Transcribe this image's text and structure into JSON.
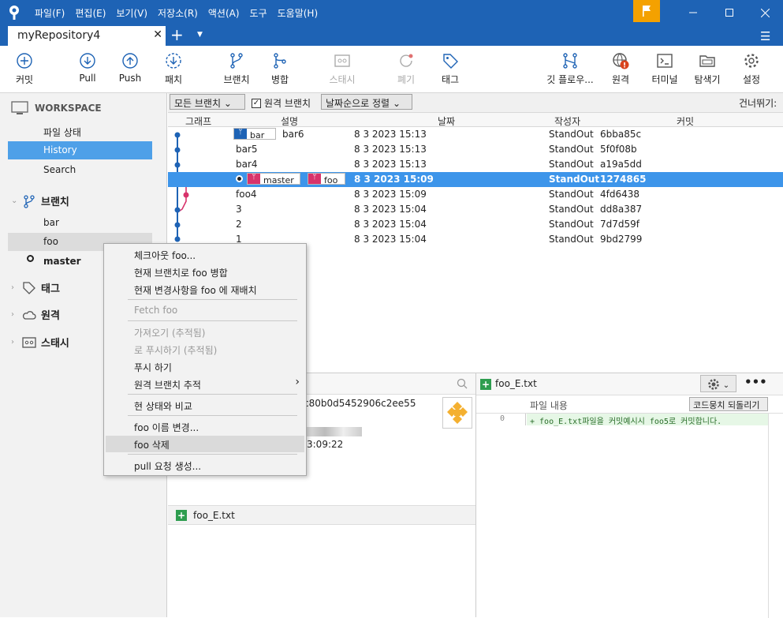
{
  "menu": [
    "파일(F)",
    "편집(E)",
    "보기(V)",
    "저장소(R)",
    "액션(A)",
    "도구",
    "도움말(H)"
  ],
  "tab": {
    "title": "myRepository4"
  },
  "toolbar": {
    "commit": "커밋",
    "pull": "Pull",
    "push": "Push",
    "fetch": "패치",
    "branch": "브랜치",
    "merge": "병합",
    "stash": "스태시",
    "discard": "폐기",
    "tag": "태그",
    "gitflow": "깃 플로우...",
    "remote": "원격",
    "terminal": "터미널",
    "explorer": "탐색기",
    "settings": "설정"
  },
  "sidebar": {
    "workspace": "WORKSPACE",
    "items": [
      {
        "label": "파일 상태"
      },
      {
        "label": "History"
      },
      {
        "label": "Search"
      }
    ],
    "branches_header": "브랜치",
    "branches": [
      {
        "label": "bar"
      },
      {
        "label": "foo"
      },
      {
        "label": "master"
      }
    ],
    "tags": "태그",
    "remotes": "원격",
    "stashes": "스태시"
  },
  "filter": {
    "all_branches": "모든 브랜치",
    "remote_branches": "원격 브랜치",
    "sort": "날짜순으로 정렬",
    "skip": "건너뛰기:"
  },
  "columns": {
    "graph": "그래프",
    "desc": "설명",
    "date": "날짜",
    "author": "작성자",
    "commit": "커밋"
  },
  "commits": [
    {
      "tags": [
        "bar"
      ],
      "desc": "bar6",
      "date": "8 3 2023 15:13",
      "author": "StandOut",
      "hash": "6bba85c"
    },
    {
      "tags": [],
      "desc": "bar5",
      "date": "8 3 2023 15:13",
      "author": "StandOut",
      "hash": "5f0f08b"
    },
    {
      "tags": [],
      "desc": "bar4",
      "date": "8 3 2023 15:13",
      "author": "StandOut",
      "hash": "a19a5dd"
    },
    {
      "tags": [
        "master",
        "foo"
      ],
      "desc": "",
      "date": "8 3 2023 15:09",
      "author": "StandOut",
      "hash": "1274865"
    },
    {
      "tags": [],
      "desc": "foo4",
      "date": "8 3 2023 15:09",
      "author": "StandOut",
      "hash": "4fd6438"
    },
    {
      "tags": [],
      "desc": "3",
      "date": "8 3 2023 15:04",
      "author": "StandOut",
      "hash": "dd8a387"
    },
    {
      "tags": [],
      "desc": "2",
      "date": "8 3 2023 15:04",
      "author": "StandOut",
      "hash": "7d7d59f"
    },
    {
      "tags": [],
      "desc": "1",
      "date": "8 3 2023 15:04",
      "author": "StandOut",
      "hash": "9bd2799"
    }
  ],
  "details": {
    "hash_suffix": "c80b0d5452906c2ee55",
    "time": "3:09:22",
    "file": "foo_E.txt"
  },
  "diff": {
    "file": "foo_E.txt",
    "header": "파일 내용",
    "revert": "코드뭉치 되돌리기",
    "line_no": "0",
    "line": "+ foo_E.txt파일을 커밋예시시 foo5로 커밋합니다."
  },
  "context_menu": [
    {
      "label": "체크아웃 foo...",
      "enabled": true
    },
    {
      "label": "현재 브랜치로 foo 병합",
      "enabled": true
    },
    {
      "label": "현재 변경사항을 foo 에 재배치",
      "enabled": true
    },
    {
      "label": "Fetch foo",
      "enabled": false
    },
    {
      "label": "가져오기 (추적됨)",
      "enabled": false
    },
    {
      "label": "로 푸시하기 (추적됨)",
      "enabled": false
    },
    {
      "label": "푸시 하기",
      "enabled": true
    },
    {
      "label": "원격 브랜치 추적",
      "enabled": true
    },
    {
      "label": "현 상태와 비교",
      "enabled": true
    },
    {
      "label": "foo 이름 변경...",
      "enabled": true
    },
    {
      "label": "foo 삭제",
      "enabled": true
    },
    {
      "label": "pull 요청 생성...",
      "enabled": true
    }
  ],
  "colors": {
    "accent": "#1e63b5",
    "selection": "#3d95ea",
    "branch_red": "#d8336b",
    "flag": "#f4a100"
  }
}
